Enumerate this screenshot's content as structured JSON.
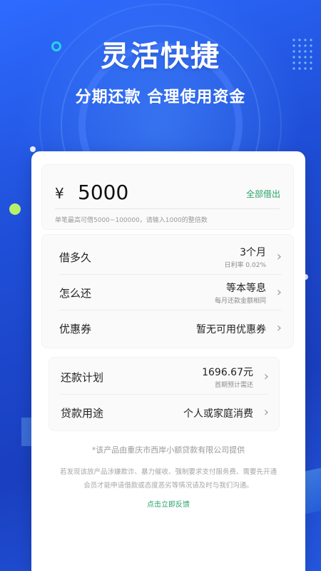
{
  "hero": {
    "title": "灵活快捷",
    "subtitle": "分期还款  合理使用资金"
  },
  "amount": {
    "currency": "¥",
    "value": "5000",
    "borrow_all_label": "全部借出",
    "hint": "单笔最高可借5000~100000，请输入1000的整倍数"
  },
  "options": [
    {
      "label": "借多久",
      "value": "3个月",
      "sub": "日利率 0.02%"
    },
    {
      "label": "怎么还",
      "value": "等本等息",
      "sub": "每月还款金额相同"
    },
    {
      "label": "优惠券",
      "value": "暂无可用优惠券",
      "sub": ""
    }
  ],
  "plan": [
    {
      "label": "还款计划",
      "value": "1696.67元",
      "sub": "首期预计需还"
    },
    {
      "label": "贷款用途",
      "value": "个人或家庭消费",
      "sub": ""
    }
  ],
  "footer": {
    "provider": "*该产品由重庆市西岸小额贷款有限公司提供",
    "notice": "若发现该放产品涉嫌欺诈、暴力催收、强制要求支付服务费、需要先开通会员才能申请借款或态度恶劣等情况请及时与我们沟通。",
    "feedback_label": "点击立即反馈"
  },
  "icons": {
    "chevron": "chevron-right-icon"
  },
  "colors": {
    "accent_green": "#2aa36b",
    "background_blue": "#1f4fd8"
  }
}
